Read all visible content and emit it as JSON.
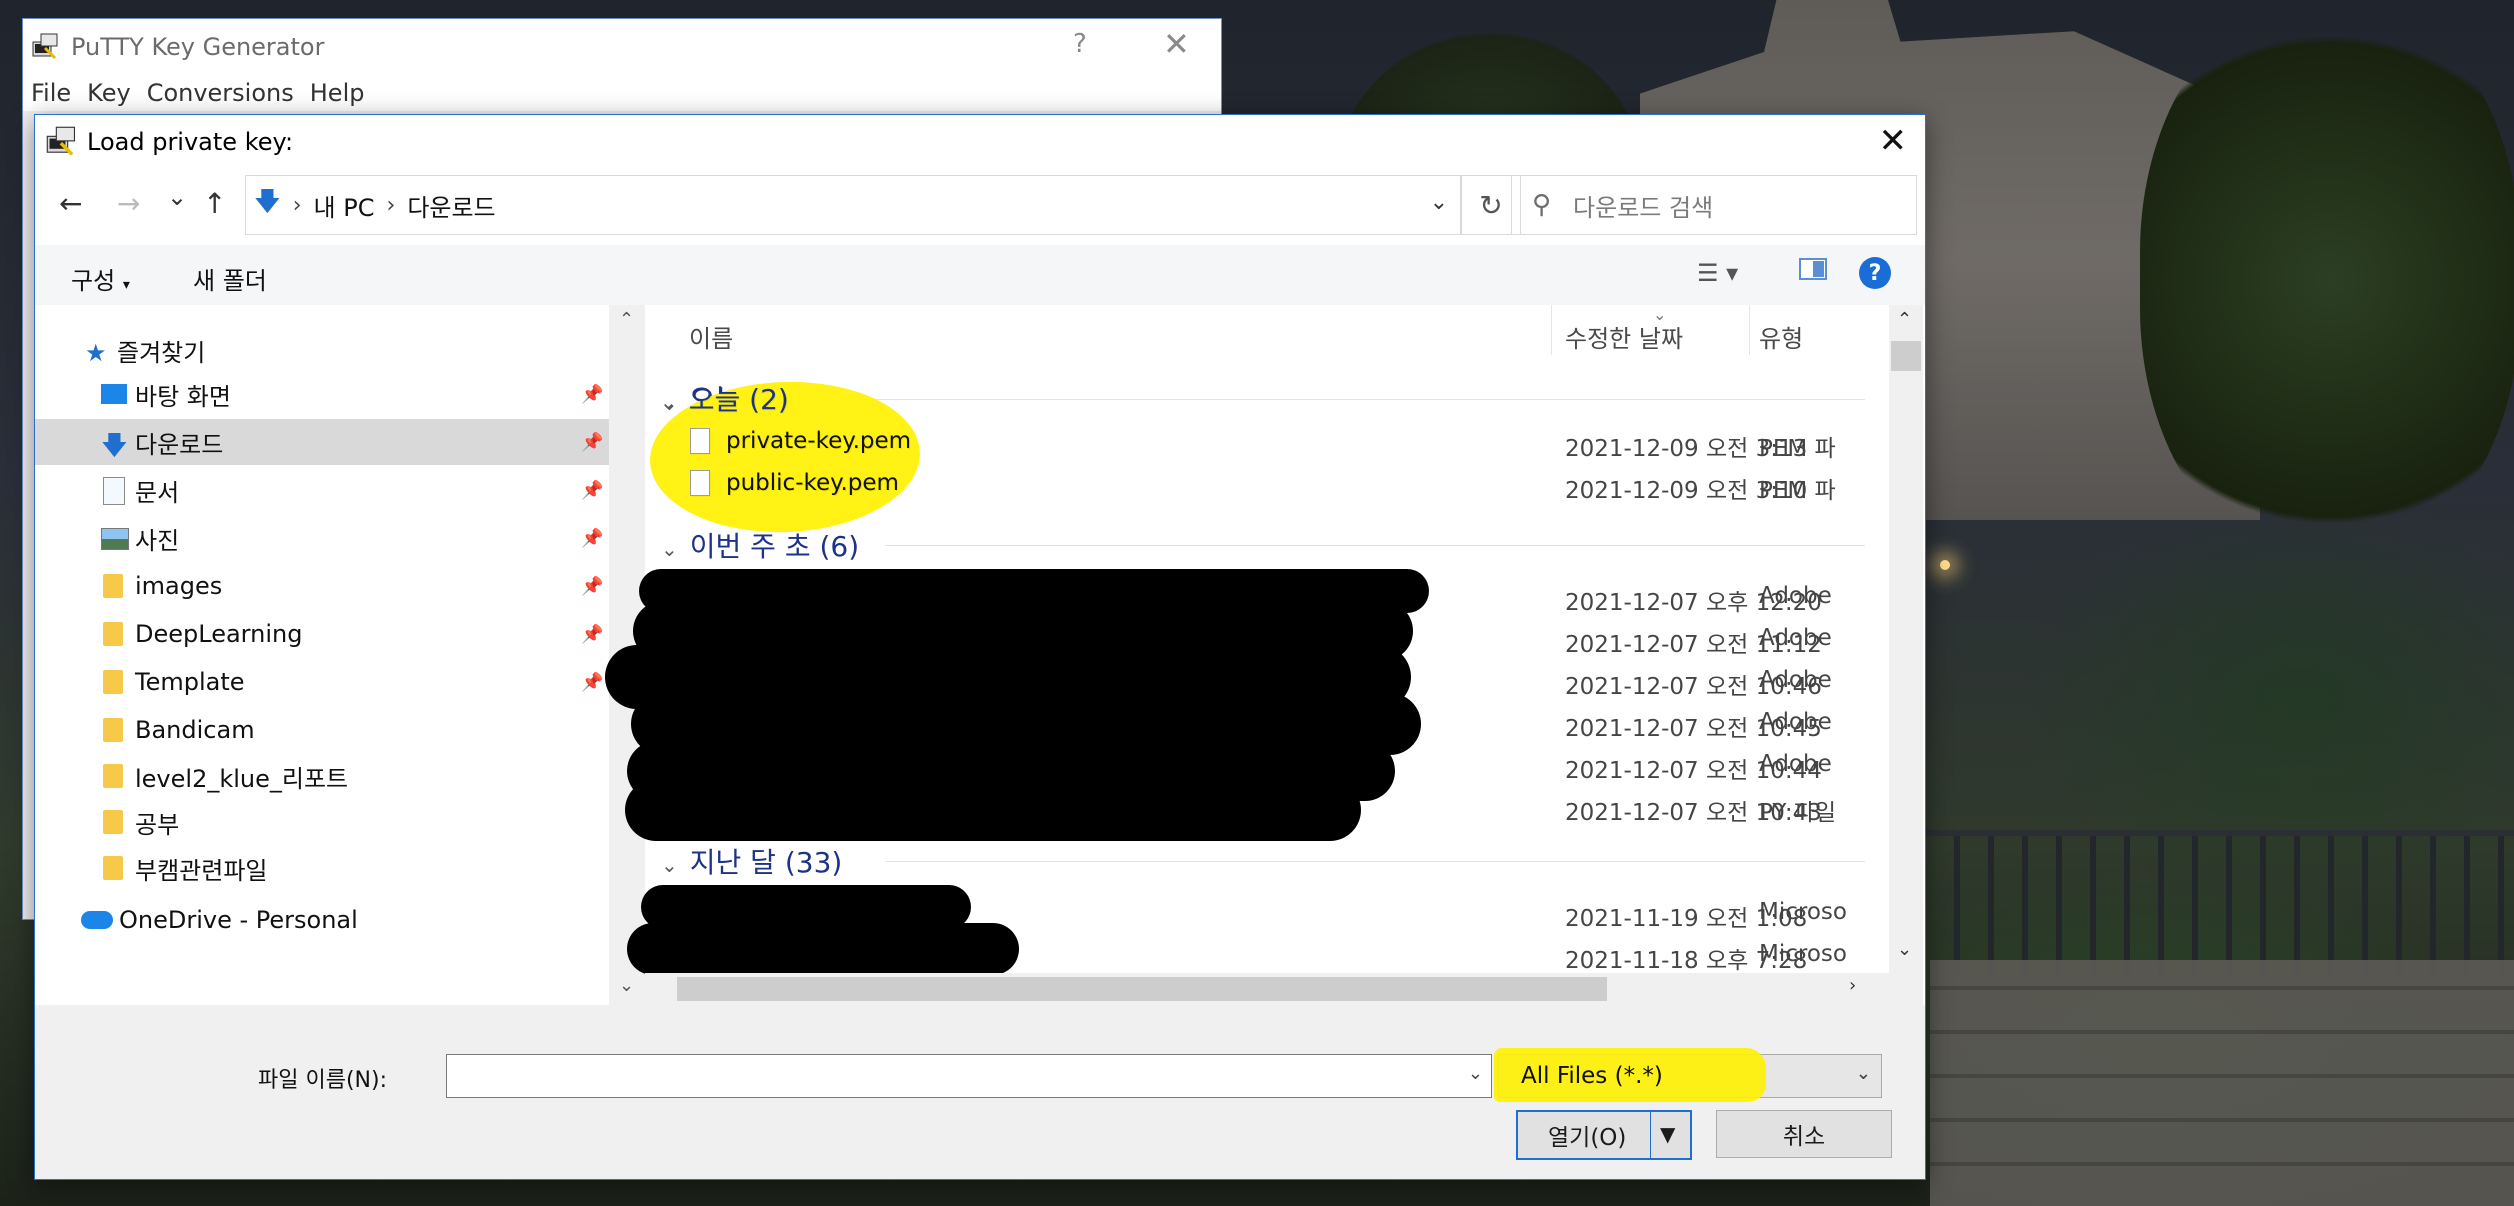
{
  "putty": {
    "title": "PuTTY Key Generator",
    "help_label": "?",
    "close_label": "✕",
    "menu": [
      "File",
      "Key",
      "Conversions",
      "Help"
    ]
  },
  "dialog": {
    "title": "Load private key:",
    "close_label": "✕",
    "nav": {
      "back": "←",
      "forward": "→",
      "recent": "⌄",
      "up": "↑",
      "breadcrumb": [
        "내 PC",
        "다운로드"
      ],
      "refresh": "↻",
      "search_placeholder": "다운로드 검색"
    },
    "commands": {
      "organize": "구성",
      "new_folder": "새 폴더",
      "help": "?"
    },
    "sidebar": {
      "items": [
        {
          "label": "즐겨찾기",
          "icon": "star-icon",
          "pinned": false
        },
        {
          "label": "바탕 화면",
          "icon": "desktop-icon",
          "pinned": true
        },
        {
          "label": "다운로드",
          "icon": "download-icon",
          "pinned": true,
          "selected": true
        },
        {
          "label": "문서",
          "icon": "document-icon",
          "pinned": true
        },
        {
          "label": "사진",
          "icon": "picture-icon",
          "pinned": true
        },
        {
          "label": "images",
          "icon": "folder-icon",
          "pinned": true
        },
        {
          "label": "DeepLearning",
          "icon": "folder-icon",
          "pinned": true
        },
        {
          "label": "Template",
          "icon": "folder-icon",
          "pinned": true
        },
        {
          "label": "Bandicam",
          "icon": "folder-icon",
          "pinned": false
        },
        {
          "label": "level2_klue_리포트",
          "icon": "folder-icon",
          "pinned": false
        },
        {
          "label": "공부",
          "icon": "folder-icon",
          "pinned": false
        },
        {
          "label": "부캠관련파일",
          "icon": "folder-icon",
          "pinned": false
        },
        {
          "label": "OneDrive - Personal",
          "icon": "onedrive-icon",
          "pinned": false
        }
      ]
    },
    "columns": {
      "name": "이름",
      "modified": "수정한 날짜",
      "type": "유형"
    },
    "groups": [
      {
        "label": "오늘 (2)",
        "rows": [
          {
            "name": "private-key.pem",
            "date": "2021-12-09 오전 3:13",
            "type": "PEM 파"
          },
          {
            "name": "public-key.pem",
            "date": "2021-12-09 오전 3:10",
            "type": "PEM 파"
          }
        ]
      },
      {
        "label": "이번 주 초 (6)",
        "rows": [
          {
            "name": "",
            "date": "2021-12-07 오후 12:20",
            "type": "Adobe"
          },
          {
            "name": "",
            "date": "2021-12-07 오전 11:12",
            "type": "Adobe"
          },
          {
            "name": "",
            "date": "2021-12-07 오전 10:46",
            "type": "Adobe"
          },
          {
            "name": "",
            "date": "2021-12-07 오전 10:45",
            "type": "Adobe"
          },
          {
            "name": "",
            "date": "2021-12-07 오전 10:44",
            "type": "Adobe"
          },
          {
            "name": "",
            "date": "2021-12-07 오전 10:43",
            "type": "PY 파일"
          }
        ]
      },
      {
        "label": "지난 달 (33)",
        "rows": [
          {
            "name": "",
            "date": "2021-11-19 오전 1:08",
            "type": "Microso"
          },
          {
            "name": "",
            "date": "2021-11-18 오후 7:28",
            "type": "Microso"
          }
        ]
      }
    ],
    "bottom": {
      "filename_label": "파일 이름(N):",
      "filename_value": "",
      "filter_value": "All Files (*.*)",
      "open_label": "열기(O)",
      "cancel_label": "취소"
    }
  },
  "colors": {
    "accent": "#1a6dd6",
    "group_header": "#1e3287",
    "highlight": "#fff100"
  }
}
